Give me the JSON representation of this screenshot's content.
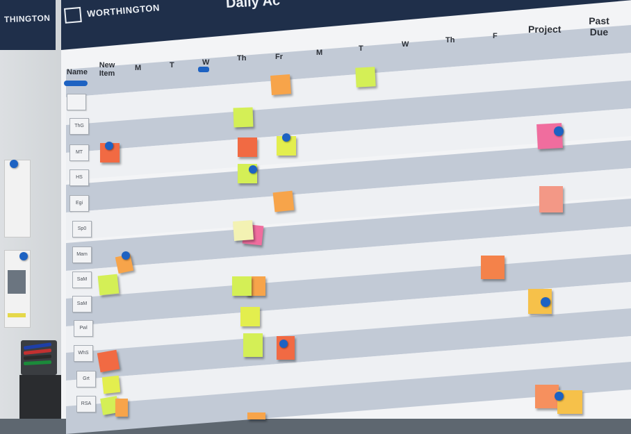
{
  "left_panel": {
    "logo": "THINGTON"
  },
  "header": {
    "brand_name": "WORTHINGTON",
    "title": "Daily Ac",
    "columns": [
      "Name",
      "New Item",
      "M",
      "T",
      "W",
      "Th",
      "Fr",
      "M",
      "T",
      "W",
      "Th",
      "F",
      "Project",
      "Past Due"
    ]
  },
  "names": [
    "",
    "ThG",
    "MT",
    "HS",
    "Egi",
    "Sp0",
    "Mam",
    "SaM",
    "SaM",
    "Pwl",
    "WhS",
    "Grt",
    "RSA"
  ],
  "colors": {
    "banner": "#1f2f4a",
    "row_gray": "#c2cad6",
    "row_white": "#eef0f3",
    "magnet": "#1d62c2"
  }
}
